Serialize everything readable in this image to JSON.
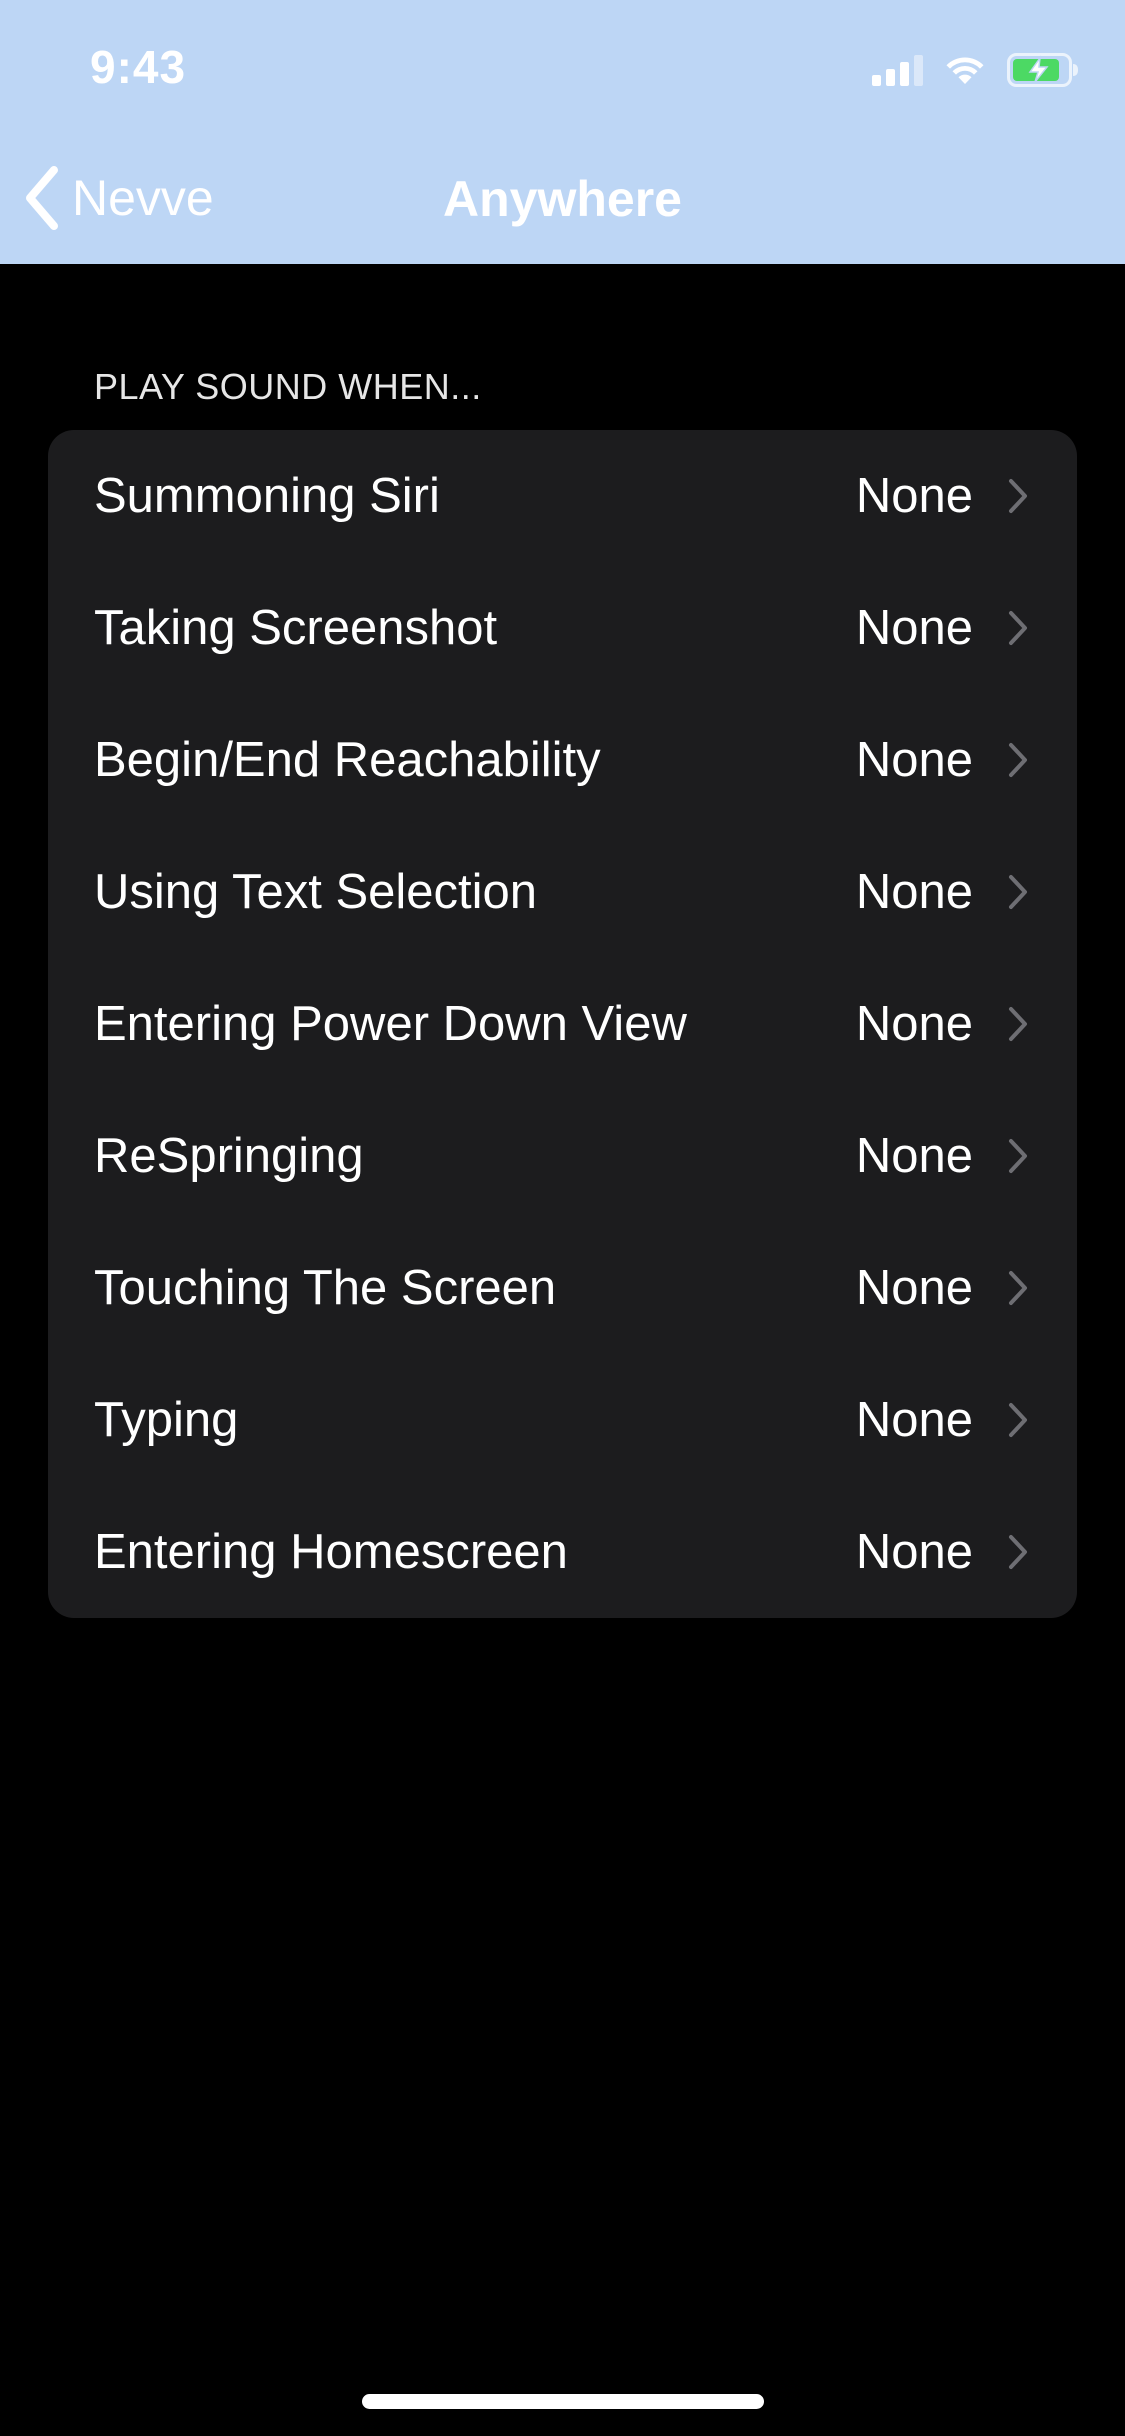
{
  "status_bar": {
    "time": "9:43",
    "signal_icon": "cellular-signal-icon",
    "wifi_icon": "wifi-icon",
    "battery_icon": "battery-charging-icon",
    "battery_color": "#4cd964"
  },
  "nav": {
    "back_label": "Nevve",
    "back_icon": "chevron-left-icon",
    "title": "Anywhere",
    "bar_color": "#bdd6f5"
  },
  "section": {
    "header": "PLAY SOUND WHEN...",
    "rows": [
      {
        "label": "Summoning Siri",
        "value": "None"
      },
      {
        "label": "Taking Screenshot",
        "value": "None"
      },
      {
        "label": "Begin/End Reachability",
        "value": "None"
      },
      {
        "label": "Using Text Selection",
        "value": "None"
      },
      {
        "label": "Entering Power Down View",
        "value": "None"
      },
      {
        "label": "ReSpringing",
        "value": "None"
      },
      {
        "label": "Touching The Screen",
        "value": "None"
      },
      {
        "label": "Typing",
        "value": "None"
      },
      {
        "label": "Entering Homescreen",
        "value": "None"
      }
    ]
  }
}
